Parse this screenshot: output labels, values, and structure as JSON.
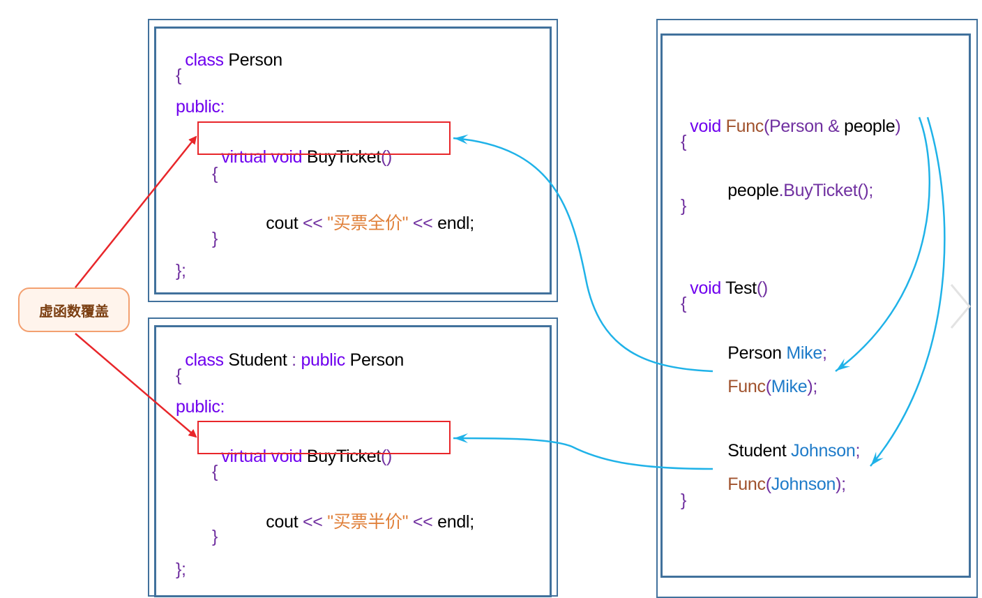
{
  "label": "虚函数覆盖",
  "person_box": {
    "line1": {
      "kw": "class",
      "name": " Person"
    },
    "line2": "{",
    "line3": "public:",
    "line4": {
      "kw": "virtual void",
      "name": " BuyTicket",
      "paren": "()"
    },
    "line5": "{",
    "line6": {
      "cout": "cout",
      "op": " << ",
      "str": "\"买票全价\"",
      "op2": " << ",
      "endl": "endl;"
    },
    "line7": "}",
    "line8": "};"
  },
  "student_box": {
    "line1": {
      "kw": "class",
      "name": " Student",
      "colon": " : ",
      "kw2": "public",
      "base": " Person"
    },
    "line2": "{",
    "line3": "public:",
    "line4": {
      "kw": "virtual void",
      "name": " BuyTicket",
      "paren": "()"
    },
    "line5": "{",
    "line6": {
      "cout": "cout",
      "op": " << ",
      "str": "\"买票半价\"",
      "op2": " << ",
      "endl": "endl;"
    },
    "line7": "}",
    "line8": "};"
  },
  "right_box": {
    "func_sig": {
      "kw": "void",
      "fn": " Func",
      "open": "(",
      "type": "Person &",
      "param": " people",
      "close": ")"
    },
    "brace_open1": "{",
    "call": {
      "obj": "people",
      "dot": ".",
      "method": "BuyTicket",
      "end": "();"
    },
    "brace_close1": "}",
    "test_sig": {
      "kw": "void",
      "name": " Test",
      "paren": "()"
    },
    "brace_open2": "{",
    "decl1": {
      "type": "Person",
      "var": " Mike",
      "semi": ";"
    },
    "call1": {
      "fn": "Func",
      "open": "(",
      "arg": "Mike",
      "close": ");"
    },
    "decl2": {
      "type": "Student",
      "var": " Johnson",
      "semi": ";"
    },
    "call2": {
      "fn": "Func",
      "open": "(",
      "arg": "Johnson",
      "close": ");"
    },
    "brace_close2": "}"
  },
  "colors": {
    "keyword": "#6f00ee",
    "punct": "#7030a0",
    "string": "#e0803a",
    "function": "#a0522d",
    "identifier": "#1e7bc9",
    "box_border": "#41719c",
    "highlight": "#e8262a",
    "arrow_blue": "#1fb2e8"
  }
}
